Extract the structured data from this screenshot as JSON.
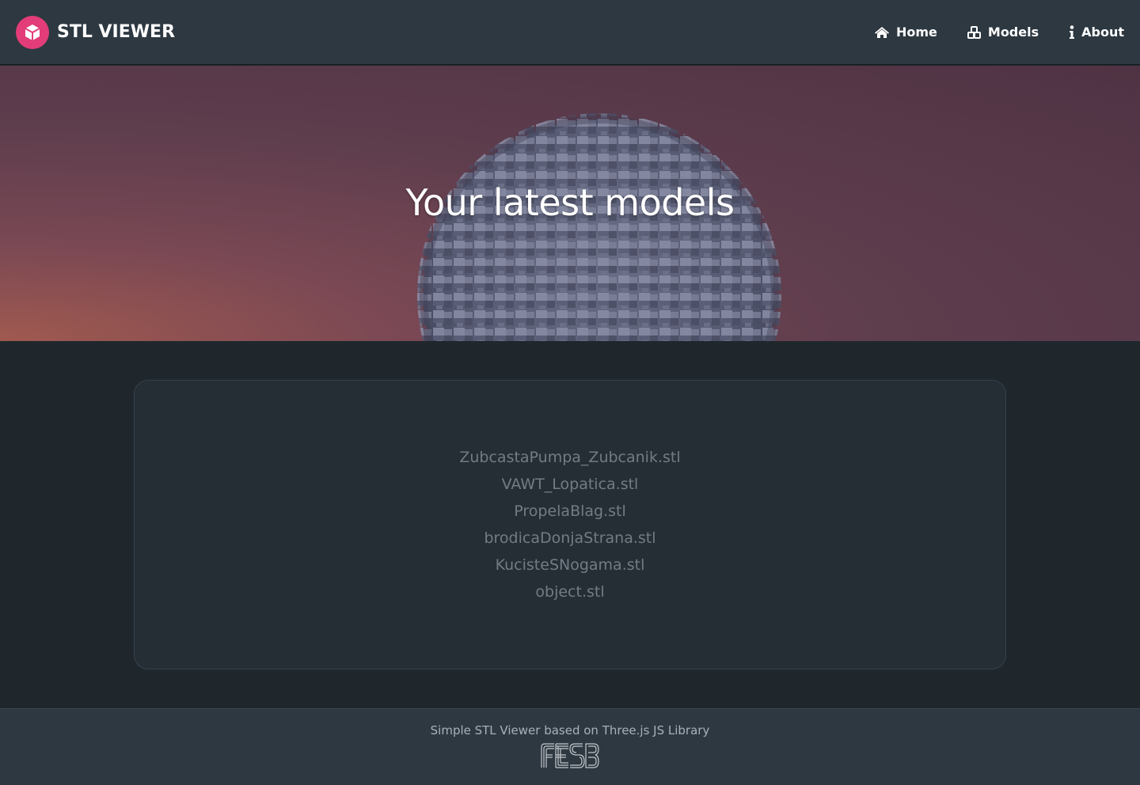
{
  "navbar": {
    "brand": "STL VIEWER",
    "links": [
      {
        "label": "Home",
        "icon": "home-icon"
      },
      {
        "label": "Models",
        "icon": "cubes-icon"
      },
      {
        "label": "About",
        "icon": "info-icon"
      }
    ]
  },
  "hero": {
    "title": "Your latest models"
  },
  "models": [
    "ZubcastaPumpa_Zubcanik.stl",
    "VAWT_Lopatica.stl",
    "PropelaBlag.stl",
    "brodicaDonjaStrana.stl",
    "KucisteSNogama.stl",
    "object.stl"
  ],
  "footer": {
    "text": "Simple STL Viewer based on Three.js JS Library",
    "logo": "FESB"
  },
  "colors": {
    "navbar": "#2d3841",
    "brand_accent": "#e23d78",
    "body": "#1f272d",
    "card": "#252d35",
    "model_text": "#737c84"
  }
}
